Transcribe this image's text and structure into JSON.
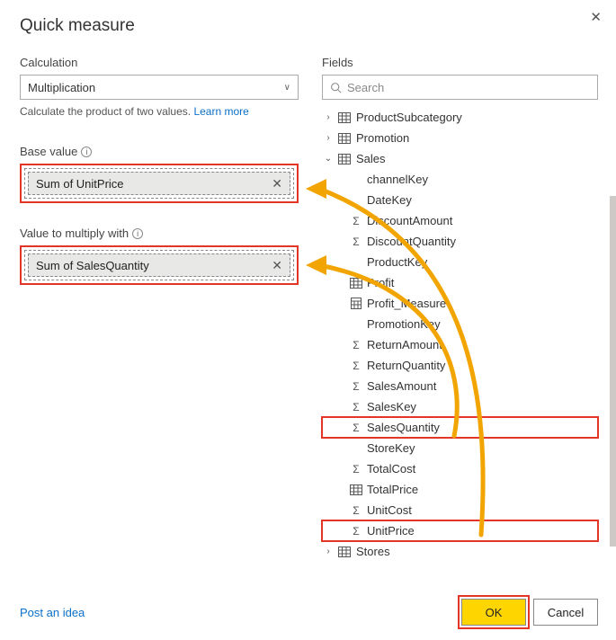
{
  "title": "Quick measure",
  "calc": {
    "head": "Calculation",
    "value": "Multiplication",
    "hint_pre": "Calculate the product of two values. ",
    "hint_link": "Learn more"
  },
  "base": {
    "head": "Base value",
    "value": "Sum of UnitPrice"
  },
  "mult": {
    "head": "Value to multiply with",
    "value": "Sum of SalesQuantity"
  },
  "fields": {
    "head": "Fields",
    "search_ph": "Search",
    "tables": {
      "ProductSubcategory": "ProductSubcategory",
      "Promotion": "Promotion",
      "Sales": "Sales",
      "Stores": "Stores"
    },
    "sales_items": [
      {
        "icon": "",
        "label": "channelKey"
      },
      {
        "icon": "",
        "label": "DateKey"
      },
      {
        "icon": "Σ",
        "label": "DiscountAmount"
      },
      {
        "icon": "Σ",
        "label": "DiscountQuantity"
      },
      {
        "icon": "",
        "label": "ProductKey"
      },
      {
        "icon": "tbl",
        "label": "Profit"
      },
      {
        "icon": "calc",
        "label": "Profit_Measure"
      },
      {
        "icon": "",
        "label": "PromotionKey"
      },
      {
        "icon": "Σ",
        "label": "ReturnAmount"
      },
      {
        "icon": "Σ",
        "label": "ReturnQuantity"
      },
      {
        "icon": "Σ",
        "label": "SalesAmount"
      },
      {
        "icon": "Σ",
        "label": "SalesKey"
      },
      {
        "icon": "Σ",
        "label": "SalesQuantity",
        "hl": true
      },
      {
        "icon": "",
        "label": "StoreKey"
      },
      {
        "icon": "Σ",
        "label": "TotalCost"
      },
      {
        "icon": "tbl",
        "label": "TotalPrice"
      },
      {
        "icon": "Σ",
        "label": "UnitCost"
      },
      {
        "icon": "Σ",
        "label": "UnitPrice",
        "hl": true
      }
    ]
  },
  "footer": {
    "idea": "Post an idea",
    "ok": "OK",
    "cancel": "Cancel"
  }
}
